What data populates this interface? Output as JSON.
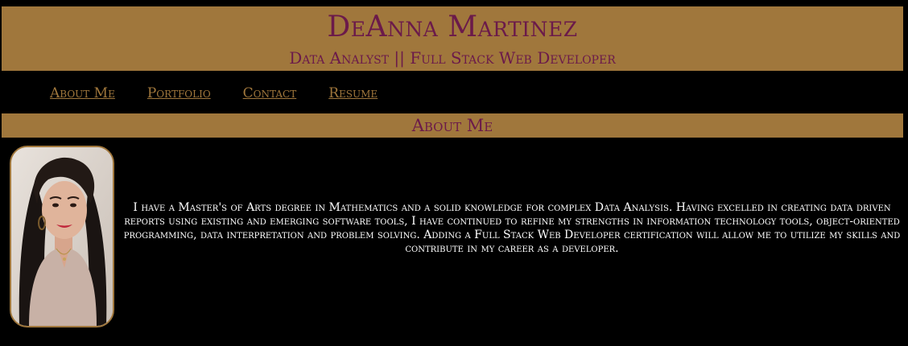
{
  "header": {
    "name": "DeAnna Martinez",
    "subtitle": "Data Analyst || Full Stack Web Developer"
  },
  "nav": {
    "items": [
      {
        "label": "About Me"
      },
      {
        "label": "Portfolio"
      },
      {
        "label": "Contact"
      },
      {
        "label": "Resume"
      }
    ]
  },
  "about": {
    "heading": "About Me",
    "photo_icon": "profile-photo",
    "text": "I have a Master's of Arts degree in Mathematics and a solid knowledge for complex Data Analysis. Having excelled in creating data driven reports using existing and emerging software tools, I have continued to refine my strengths in information technology tools, object-oriented programming, data interpretation and problem solving. Adding a Full Stack Web Developer certification will allow me to utilize my skills and contribute in my career as a developer."
  },
  "colors": {
    "accent_gold": "#a0773c",
    "title_maroon": "#6b1a4a",
    "background": "#000000",
    "body_text": "#ffffff"
  }
}
